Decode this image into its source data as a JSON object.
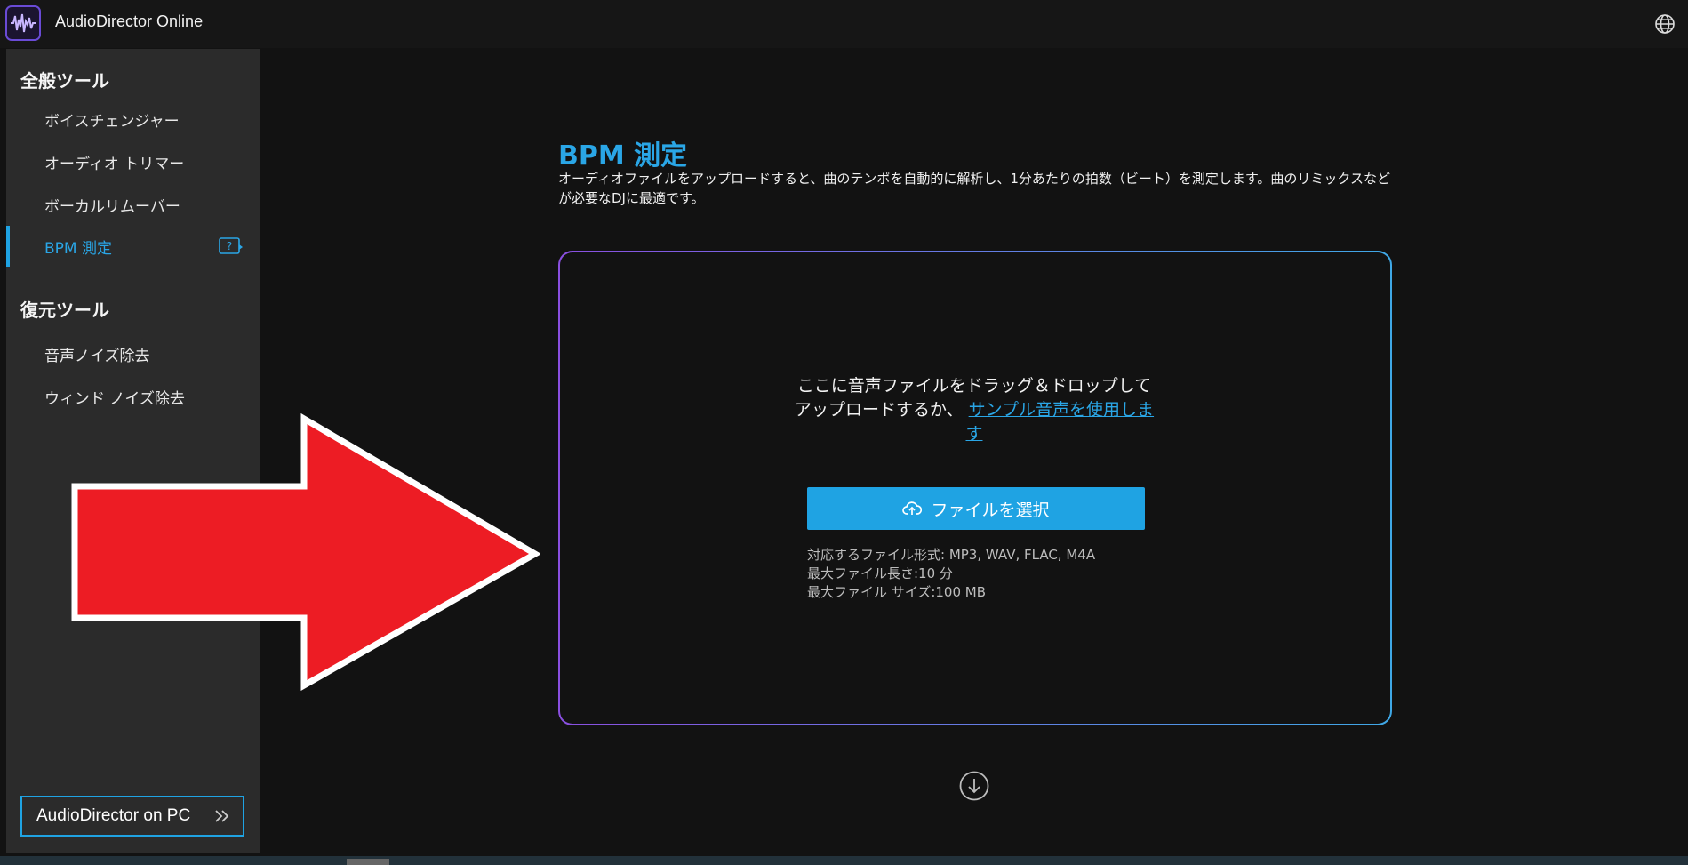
{
  "header": {
    "app_title": "AudioDirector Online",
    "logo_icon": "audio-waveform-logo",
    "language_icon": "globe-icon"
  },
  "sidebar": {
    "general_title": "全般ツール",
    "general_items": [
      {
        "label": "ボイスチェンジャー"
      },
      {
        "label": "オーディオ トリマー"
      },
      {
        "label": "ボーカルリムーバー"
      },
      {
        "label": "BPM 測定",
        "active": true
      }
    ],
    "restore_title": "復元ツール",
    "restore_items": [
      {
        "label": "音声ノイズ除去"
      },
      {
        "label": "ウィンド ノイズ除去"
      }
    ],
    "pc_button_label": "AudioDirector on PC"
  },
  "main": {
    "title": "BPM 測定",
    "description": "オーディオファイルをアップロードすると、曲のテンポを自動的に解析し、1分あたりの拍数（ビート）を測定します。曲のリミックスなどが必要なDJに最適です。",
    "dropzone": {
      "drag_text": "ここに音声ファイルをドラッグ＆ドロップしてアップロードするか、",
      "sample_link": "サンプル音声を使用します",
      "select_button": "ファイルを選択",
      "formats_line": "対応するファイル形式: MP3, WAV, FLAC, M4A",
      "max_length_line": "最大ファイル長さ:10 分",
      "max_size_line": "最大ファイル サイズ:100 MB"
    }
  },
  "colors": {
    "accent": "#1fa3e3",
    "sidebar_bg": "#2b2b2b",
    "page_bg": "#121212",
    "overlay_arrow": "#ed1c24"
  }
}
